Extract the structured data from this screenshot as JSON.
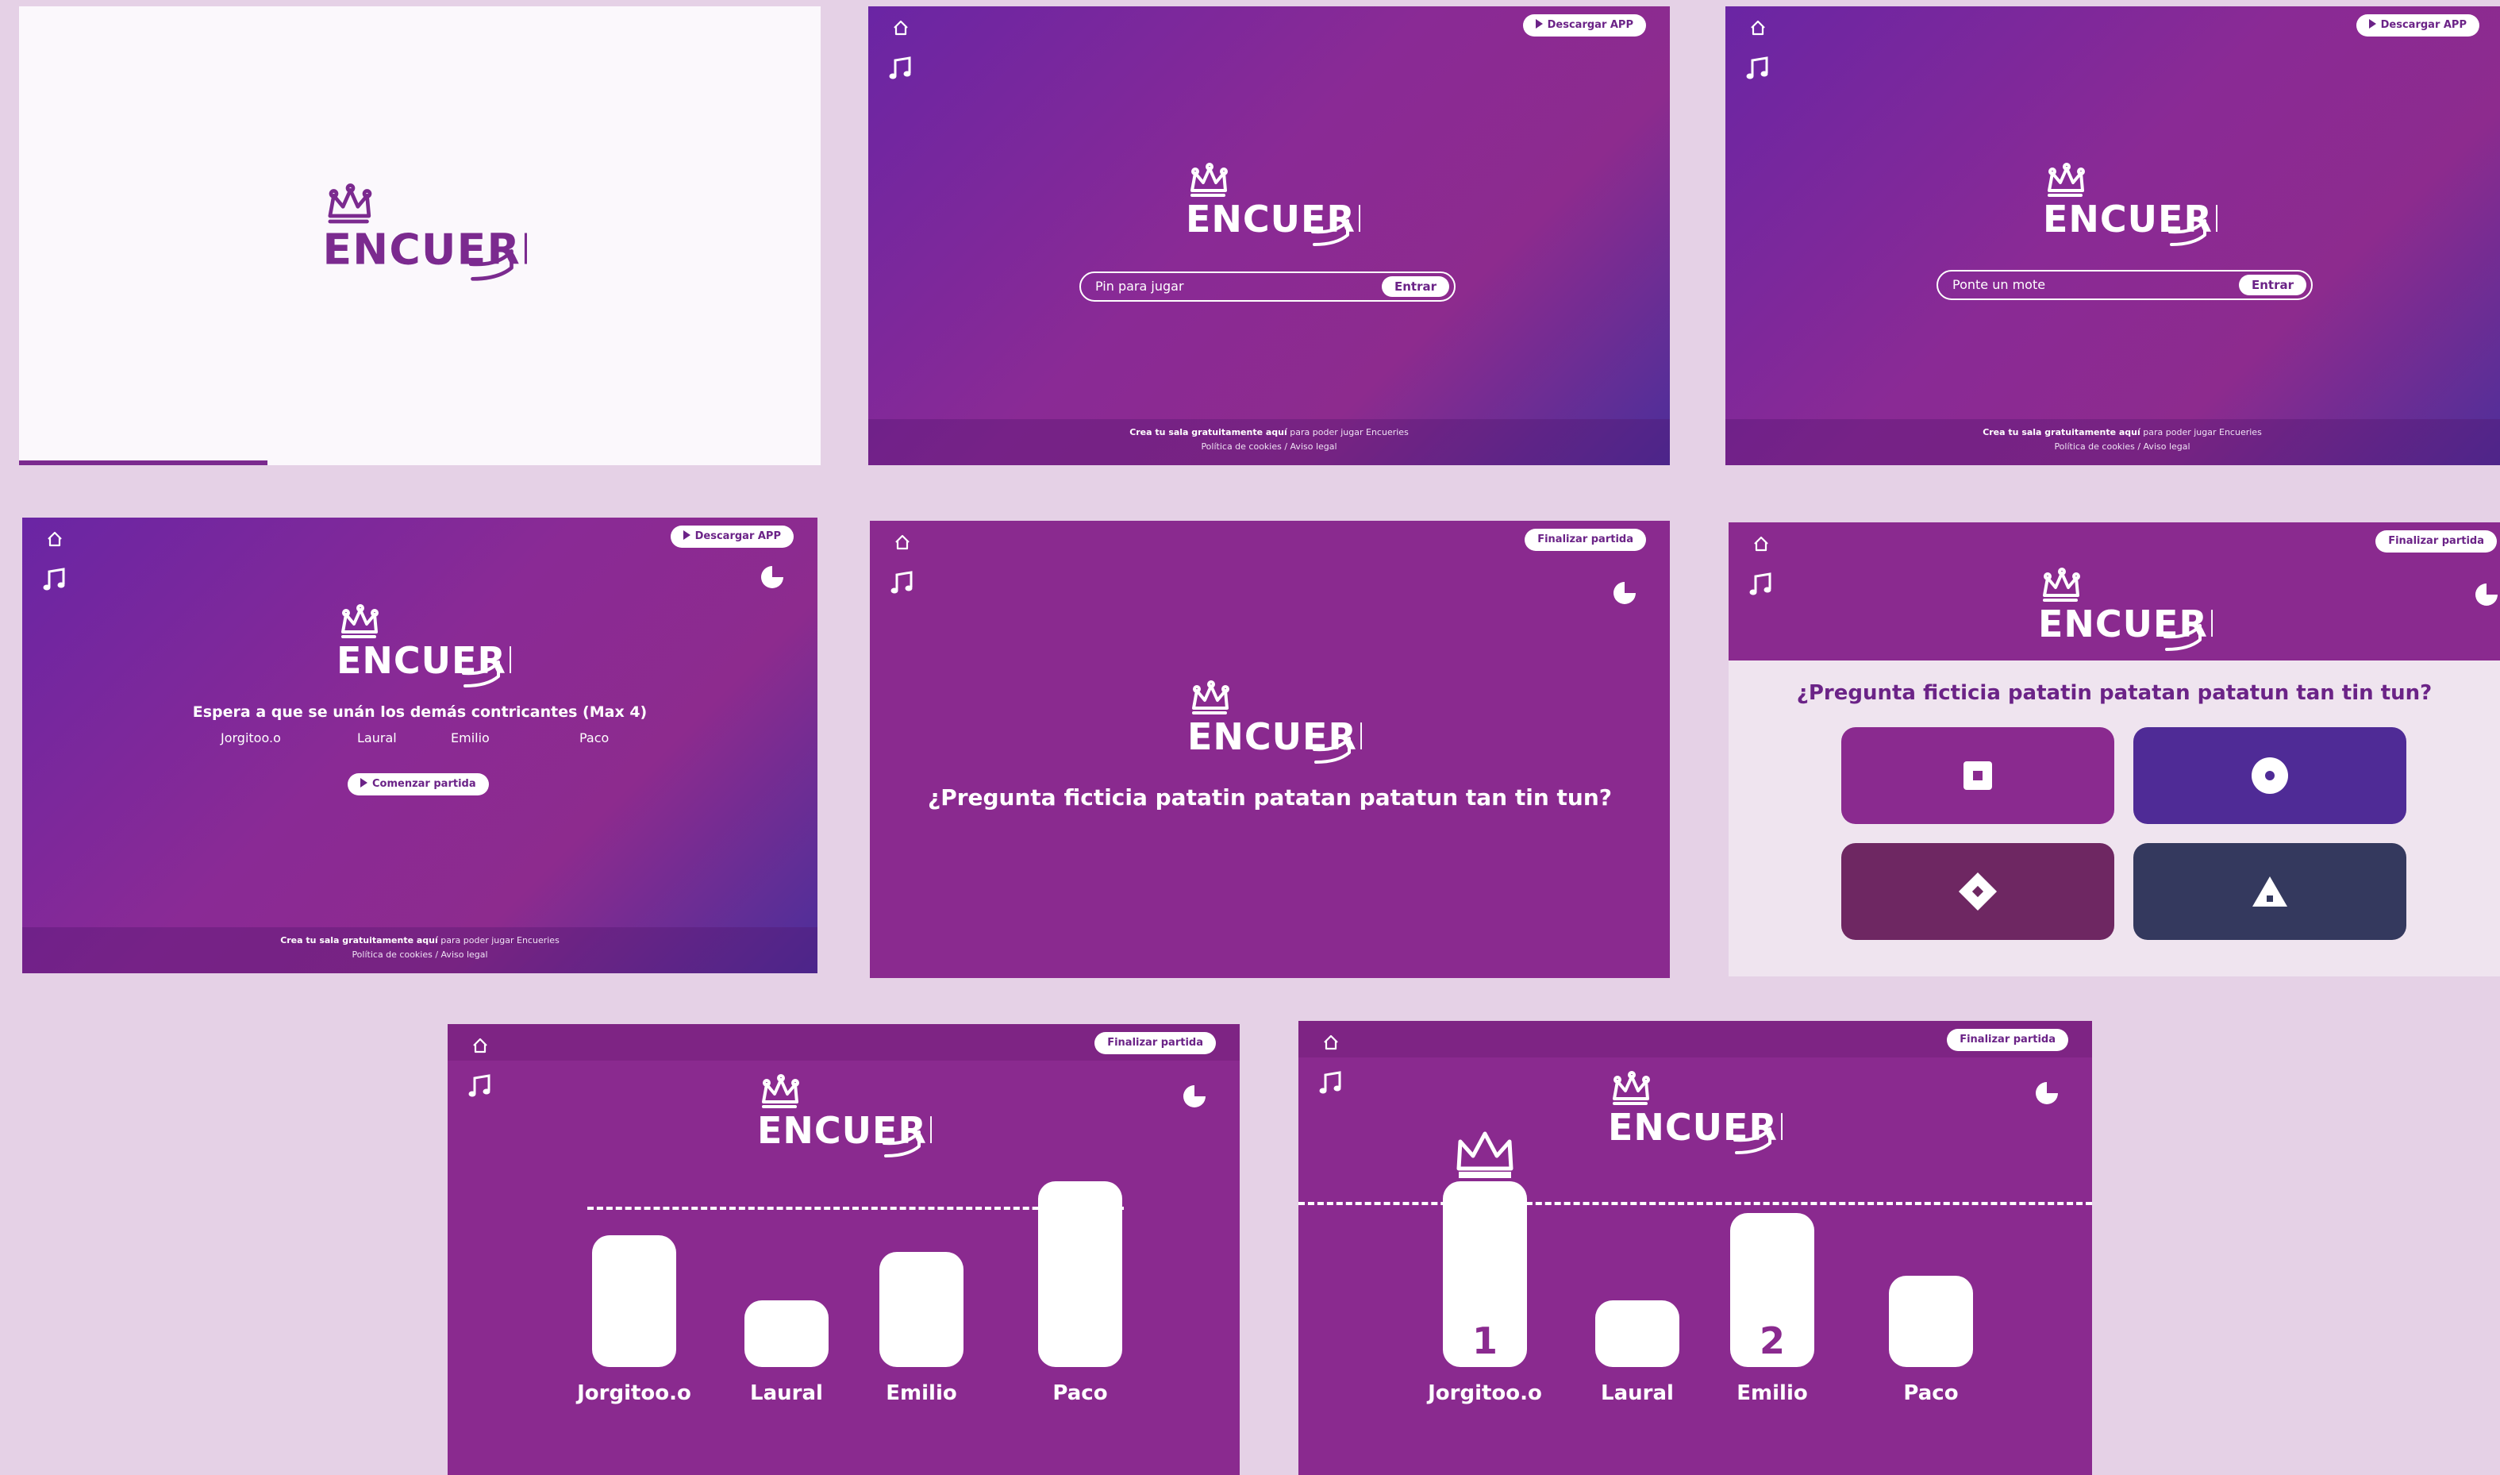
{
  "brand": {
    "logo_text": "ENCUERIES",
    "accent": "#8a2a8f",
    "white": "#ffffff"
  },
  "common": {
    "download_label": "Descargar APP",
    "finish_label": "Finalizar partida",
    "footer_line1_bold": "Crea tu sala gratuitamente aquí",
    "footer_line1_rest": " para poder jugar Encueries",
    "footer_line2": "Política de cookies / Aviso legal",
    "icons": {
      "home": "home-icon",
      "music": "music-note-icon",
      "timer": "timer-icon"
    }
  },
  "screens": {
    "splash": {
      "progress_fraction": 0.31
    },
    "pin": {
      "placeholder": "Pin para jugar",
      "enter_label": "Entrar"
    },
    "nickname": {
      "placeholder": "Ponte un mote",
      "enter_label": "Entrar"
    },
    "lobby": {
      "waiting_text": "Espera a que se unán los demás contricantes (Max 4)",
      "players": [
        "Jorgitoo.o",
        "Laural",
        "Emilio",
        "Paco"
      ],
      "start_label": "Comenzar partida"
    },
    "question": {
      "text": "¿Pregunta ficticia patatin patatan patatun tan tin tun?"
    },
    "answers": {
      "text": "¿Pregunta ficticia patatin patatan patatun tan tin tun?",
      "options": [
        {
          "shape": "square",
          "color": "#8a2a8f"
        },
        {
          "shape": "circle",
          "color": "#4f2b96"
        },
        {
          "shape": "diamond",
          "color": "#6e2762"
        },
        {
          "shape": "triangle",
          "color": "#34395e"
        }
      ]
    },
    "scores": {
      "players": [
        "Jorgitoo.o",
        "Laural",
        "Emilio",
        "Paco"
      ],
      "levels": [
        0.71,
        0.36,
        0.62,
        1.0
      ]
    },
    "podium": {
      "players": [
        "Jorgitoo.o",
        "Laural",
        "Emilio",
        "Paco"
      ],
      "levels": [
        1.0,
        0.36,
        0.83,
        0.49
      ],
      "ranks": [
        "1",
        "",
        "2",
        ""
      ],
      "winner_icon": "crown-icon"
    }
  }
}
